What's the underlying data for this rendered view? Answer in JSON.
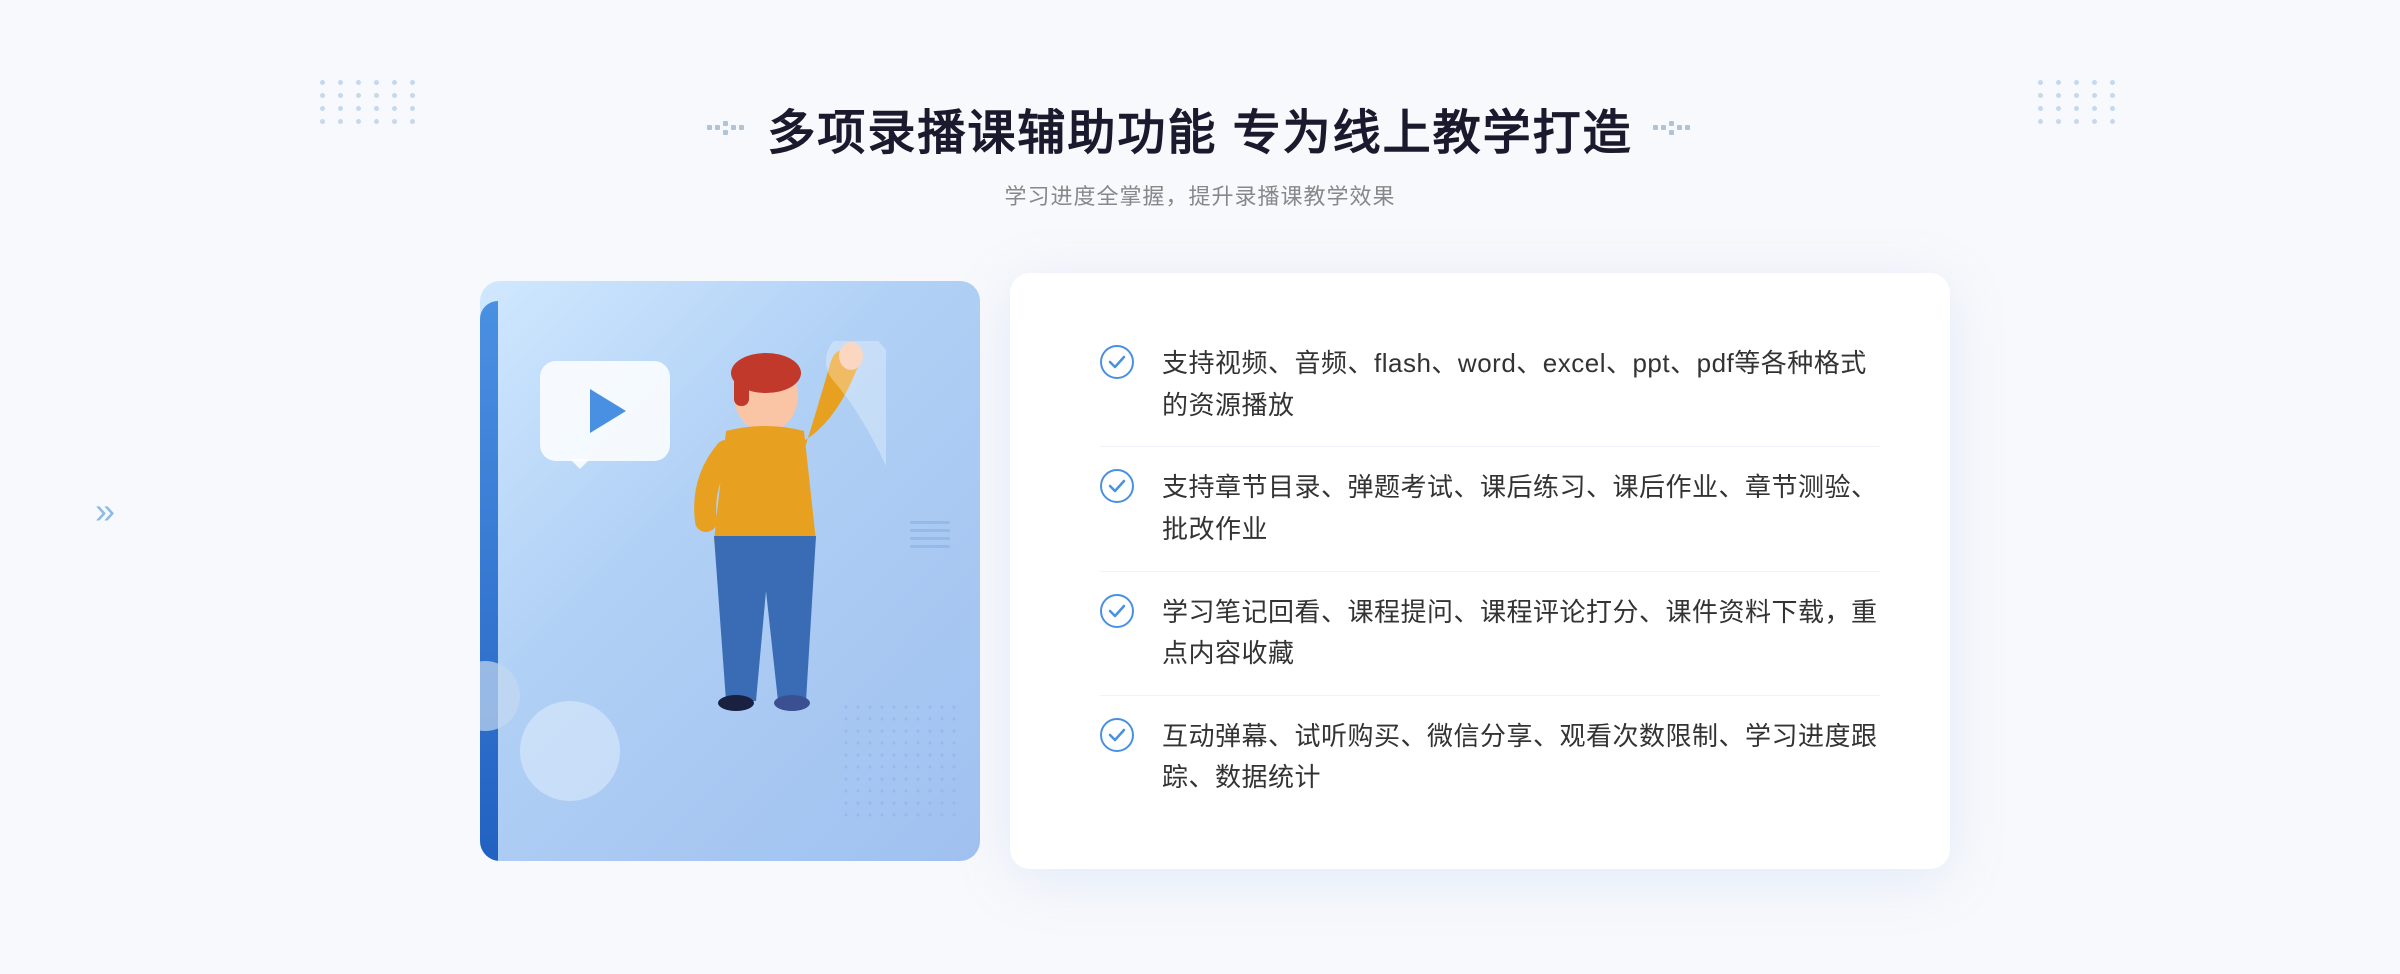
{
  "page": {
    "background_color": "#f8f9fc"
  },
  "header": {
    "title": "多项录播课辅助功能 专为线上教学打造",
    "subtitle": "学习进度全掌握，提升录播课教学效果",
    "dots_decoration": ":::"
  },
  "features": [
    {
      "id": 1,
      "text": "支持视频、音频、flash、word、excel、ppt、pdf等各种格式的资源播放"
    },
    {
      "id": 2,
      "text": "支持章节目录、弹题考试、课后练习、课后作业、章节测验、批改作业"
    },
    {
      "id": 3,
      "text": "学习笔记回看、课程提问、课程评论打分、课件资料下载，重点内容收藏"
    },
    {
      "id": 4,
      "text": "互动弹幕、试听购买、微信分享、观看次数限制、学习进度跟踪、数据统计"
    }
  ],
  "illustration": {
    "play_button_aria": "play-button",
    "person_aria": "teacher-figure"
  }
}
